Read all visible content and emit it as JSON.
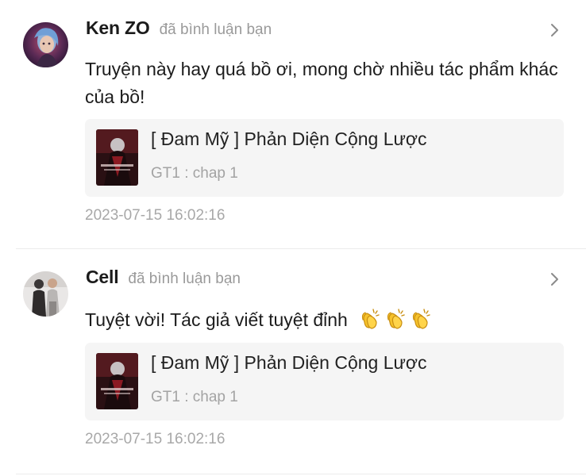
{
  "notifications": [
    {
      "username": "Ken ZO",
      "action_text": "đã bình luận bạn",
      "comment": "Truyện này hay quá bồ ơi, mong chờ nhiều tác phẩm khác của bồ!",
      "book": {
        "title": "[ Đam Mỹ ] Phản Diện Cộng Lược",
        "chapter": "GT1 : chap 1"
      },
      "timestamp": "2023-07-15 16:02:16"
    },
    {
      "username": "Cell",
      "action_text": "đã bình luận bạn",
      "comment": "Tuyệt vời! Tác giả viết tuyệt đỉnh",
      "comment_emojis": [
        "clapping-hands",
        "clapping-hands",
        "clapping-hands"
      ],
      "book": {
        "title": "[ Đam Mỹ ] Phản Diện Cộng Lược",
        "chapter": "GT1 : chap 1"
      },
      "timestamp": "2023-07-15 16:02:16"
    }
  ],
  "icons": {
    "chevron": "chevron-right-icon",
    "emoji": "clapping-hands-emoji"
  },
  "colors": {
    "username": "#1b1b1b",
    "muted_text": "#9a9a9a",
    "card_background": "#f5f5f5",
    "emoji_yellow": "#f6c22b"
  }
}
